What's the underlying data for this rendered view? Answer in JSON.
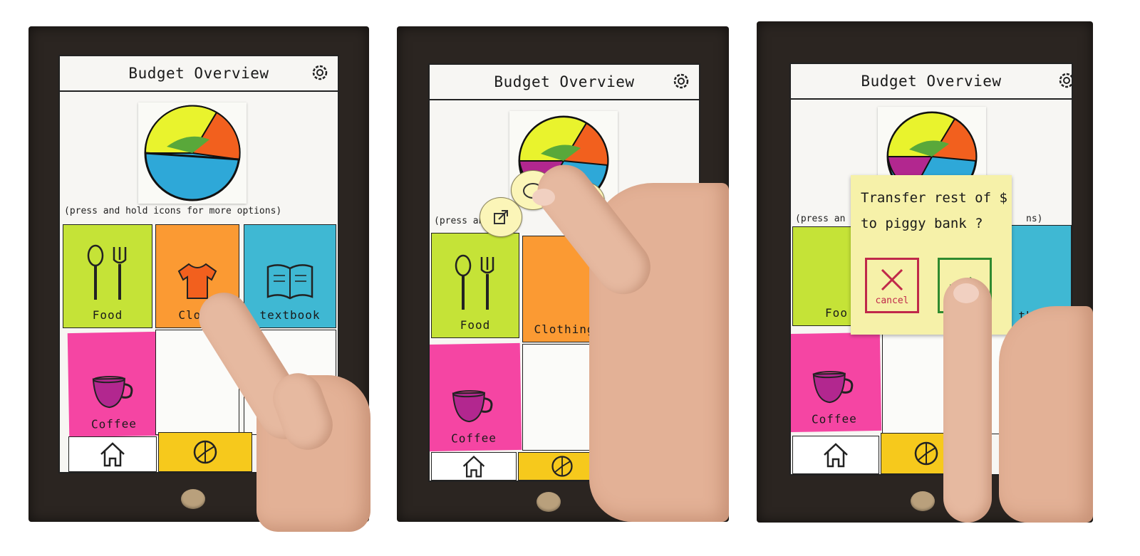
{
  "app": {
    "title": "Budget Overview",
    "hint": "(press and hold icons for more options)",
    "hint_short_left": "(press an",
    "hint_short_right": "option",
    "hint_short_right3": "ns)"
  },
  "categories": [
    {
      "label": "Food",
      "color": "#c5e337"
    },
    {
      "label": "Clothing",
      "color": "#fb9a33"
    },
    {
      "label": "textbook",
      "color": "#3fb8d3"
    },
    {
      "label": "Coffee",
      "color": "#f545a3"
    }
  ],
  "labels": {
    "clothing_partial": "Clo    g",
    "food_partial": "Foo",
    "textbook_partial": "tbook"
  },
  "nav": {
    "home_color": "#ffffff",
    "budget_color": "#f6c91c"
  },
  "pie": {
    "colors": [
      "#e9f32d",
      "#59a83a",
      "#f2601e",
      "#2ea8d8",
      "#b2278f"
    ]
  },
  "dialog": {
    "line1": "Transfer rest of $",
    "line2": "to piggy bank ?",
    "cancel_label": "cancel"
  }
}
